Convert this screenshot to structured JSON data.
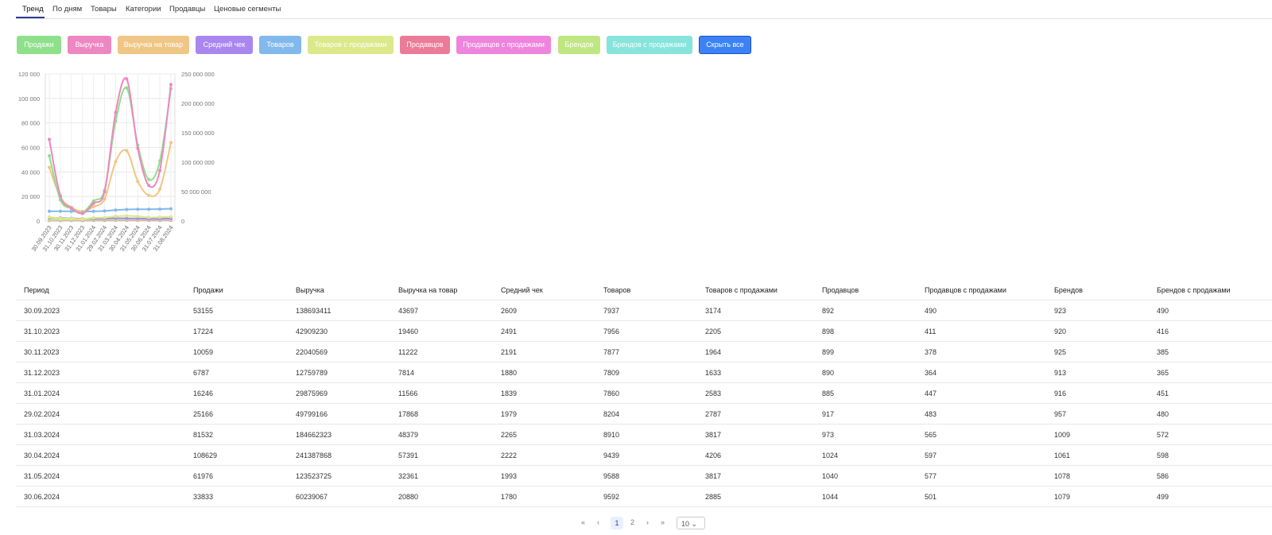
{
  "tabs": [
    "Тренд",
    "По дням",
    "Товары",
    "Категории",
    "Продавцы",
    "Ценовые сегменты"
  ],
  "metric_buttons": [
    {
      "label": "Продажи",
      "color": "#8ee08a"
    },
    {
      "label": "Выручка",
      "color": "#ee86c2"
    },
    {
      "label": "Выручка на товар",
      "color": "#f0c685"
    },
    {
      "label": "Средний чек",
      "color": "#a987ef"
    },
    {
      "label": "Товаров",
      "color": "#82b9ec"
    },
    {
      "label": "Товаров с продажами",
      "color": "#dce98a"
    },
    {
      "label": "Продавцов",
      "color": "#ec7b98"
    },
    {
      "label": "Продавцов с продажами",
      "color": "#ee84dd"
    },
    {
      "label": "Брендов",
      "color": "#c0e682"
    },
    {
      "label": "Брендов с продажами",
      "color": "#86e4dc"
    }
  ],
  "hide_all_button": {
    "label": "Скрыть все",
    "color": "#3b82f6"
  },
  "chart_data": {
    "type": "line",
    "x": [
      "30.09.2023",
      "31.10.2023",
      "30.11.2023",
      "31.12.2023",
      "31.01.2024",
      "29.02.2024",
      "31.03.2024",
      "30.04.2024",
      "31.05.2024",
      "30.06.2024",
      "31.07.2024",
      "31.08.2024"
    ],
    "left_axis": {
      "ylim": [
        0,
        120000
      ],
      "ticks": [
        "0",
        "20 000",
        "40 000",
        "60 000",
        "80 000",
        "100 000",
        "120 000"
      ]
    },
    "right_axis": {
      "ylim": [
        0,
        250000000
      ],
      "ticks": [
        "0",
        "50 000 000",
        "100 000 000",
        "150 000 000",
        "200 000 000",
        "250 000 000"
      ]
    },
    "series": [
      {
        "name": "Выручка",
        "axis": "right",
        "color": "#ee86c2",
        "values": [
          138693411,
          42909230,
          22040569,
          12759789,
          29875969,
          49799166,
          184662323,
          241387868,
          123523725,
          60239067,
          86000000,
          232000000
        ]
      },
      {
        "name": "Продажи",
        "axis": "left",
        "color": "#8ee08a",
        "values": [
          53155,
          17224,
          10059,
          6787,
          16246,
          25166,
          81532,
          108629,
          61976,
          33833,
          49000,
          108000
        ]
      },
      {
        "name": "Выручка на товар",
        "axis": "left",
        "color": "#f0c685",
        "values": [
          43697,
          19460,
          11222,
          7814,
          11566,
          17868,
          48379,
          57391,
          32361,
          20880,
          26000,
          64000
        ]
      },
      {
        "name": "Товаров",
        "axis": "left",
        "color": "#82b9ec",
        "values": [
          7937,
          7956,
          7877,
          7809,
          7860,
          8204,
          8910,
          9439,
          9588,
          9592,
          9700,
          10000
        ]
      },
      {
        "name": "Товаров с продажами",
        "axis": "left",
        "color": "#dce98a",
        "values": [
          3174,
          2205,
          1964,
          1633,
          2583,
          2787,
          3817,
          4206,
          3817,
          2885,
          3100,
          3500
        ]
      },
      {
        "name": "Средний чек",
        "axis": "left",
        "color": "#a987ef",
        "values": [
          2609,
          2491,
          2191,
          1880,
          1839,
          1979,
          2265,
          2222,
          1993,
          1780,
          1850,
          2100
        ]
      },
      {
        "name": "Брендов",
        "axis": "left",
        "color": "#c0e682",
        "values": [
          923,
          920,
          925,
          913,
          916,
          957,
          1009,
          1061,
          1078,
          1079,
          1080,
          1100
        ]
      },
      {
        "name": "Продавцов",
        "axis": "left",
        "color": "#ec7b98",
        "values": [
          892,
          898,
          899,
          890,
          885,
          917,
          973,
          1024,
          1040,
          1044,
          1050,
          1070
        ]
      },
      {
        "name": "Продавцов с продажами",
        "axis": "left",
        "color": "#ee84dd",
        "values": [
          490,
          411,
          378,
          364,
          447,
          483,
          565,
          597,
          577,
          501,
          520,
          560
        ]
      },
      {
        "name": "Брендов с продажами",
        "axis": "left",
        "color": "#86e4dc",
        "values": [
          490,
          416,
          385,
          365,
          451,
          480,
          572,
          598,
          586,
          499,
          520,
          560
        ]
      }
    ]
  },
  "table": {
    "columns": [
      "Период",
      "Продажи",
      "Выручка",
      "Выручка на товар",
      "Средний чек",
      "Товаров",
      "Товаров с продажами",
      "Продавцов",
      "Продавцов с продажами",
      "Брендов",
      "Брендов с продажами"
    ],
    "rows": [
      [
        "30.09.2023",
        "53155",
        "138693411",
        "43697",
        "2609",
        "7937",
        "3174",
        "892",
        "490",
        "923",
        "490"
      ],
      [
        "31.10.2023",
        "17224",
        "42909230",
        "19460",
        "2491",
        "7956",
        "2205",
        "898",
        "411",
        "920",
        "416"
      ],
      [
        "30.11.2023",
        "10059",
        "22040569",
        "11222",
        "2191",
        "7877",
        "1964",
        "899",
        "378",
        "925",
        "385"
      ],
      [
        "31.12.2023",
        "6787",
        "12759789",
        "7814",
        "1880",
        "7809",
        "1633",
        "890",
        "364",
        "913",
        "365"
      ],
      [
        "31.01.2024",
        "16246",
        "29875969",
        "11566",
        "1839",
        "7860",
        "2583",
        "885",
        "447",
        "916",
        "451"
      ],
      [
        "29.02.2024",
        "25166",
        "49799166",
        "17868",
        "1979",
        "8204",
        "2787",
        "917",
        "483",
        "957",
        "480"
      ],
      [
        "31.03.2024",
        "81532",
        "184662323",
        "48379",
        "2265",
        "8910",
        "3817",
        "973",
        "565",
        "1009",
        "572"
      ],
      [
        "30.04.2024",
        "108629",
        "241387868",
        "57391",
        "2222",
        "9439",
        "4206",
        "1024",
        "597",
        "1061",
        "598"
      ],
      [
        "31.05.2024",
        "61976",
        "123523725",
        "32361",
        "1993",
        "9588",
        "3817",
        "1040",
        "577",
        "1078",
        "586"
      ],
      [
        "30.06.2024",
        "33833",
        "60239067",
        "20880",
        "1780",
        "9592",
        "2885",
        "1044",
        "501",
        "1079",
        "499"
      ]
    ]
  },
  "pagination": {
    "first": "«",
    "prev": "‹",
    "pages": [
      "1",
      "2"
    ],
    "current": "1",
    "next": "›",
    "last": "»",
    "page_size": "10"
  }
}
